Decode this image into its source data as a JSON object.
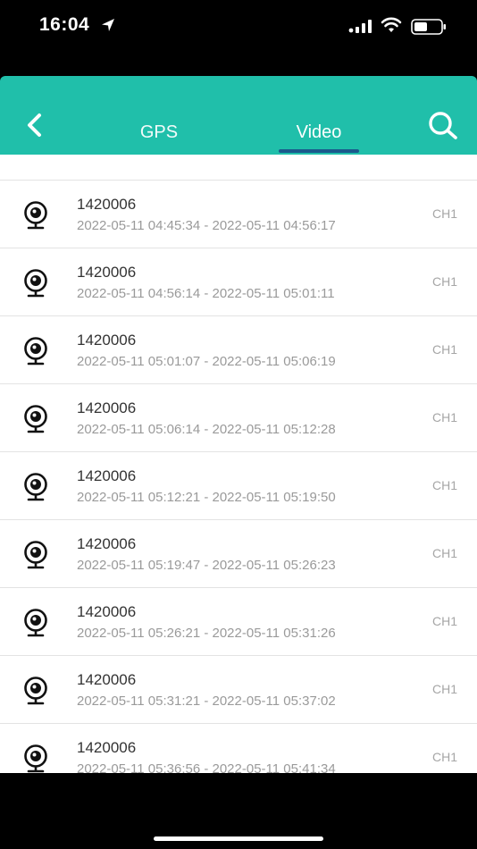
{
  "status": {
    "time": "16:04"
  },
  "header": {
    "tabs": [
      {
        "label": "GPS"
      },
      {
        "label": "Video",
        "active": true
      }
    ]
  },
  "colors": {
    "accent": "#20bfaa",
    "underline": "#1a5a8c"
  },
  "videos": [
    {
      "title": "1420006",
      "range": "2022-05-11 04:45:34 - 2022-05-11 04:56:17",
      "channel": "CH1"
    },
    {
      "title": "1420006",
      "range": "2022-05-11 04:56:14 - 2022-05-11 05:01:11",
      "channel": "CH1"
    },
    {
      "title": "1420006",
      "range": "2022-05-11 05:01:07 - 2022-05-11 05:06:19",
      "channel": "CH1"
    },
    {
      "title": "1420006",
      "range": "2022-05-11 05:06:14 - 2022-05-11 05:12:28",
      "channel": "CH1"
    },
    {
      "title": "1420006",
      "range": "2022-05-11 05:12:21 - 2022-05-11 05:19:50",
      "channel": "CH1"
    },
    {
      "title": "1420006",
      "range": "2022-05-11 05:19:47 - 2022-05-11 05:26:23",
      "channel": "CH1"
    },
    {
      "title": "1420006",
      "range": "2022-05-11 05:26:21 - 2022-05-11 05:31:26",
      "channel": "CH1"
    },
    {
      "title": "1420006",
      "range": "2022-05-11 05:31:21 - 2022-05-11 05:37:02",
      "channel": "CH1"
    },
    {
      "title": "1420006",
      "range": "2022-05-11 05:36:56 - 2022-05-11 05:41:34",
      "channel": "CH1"
    }
  ]
}
